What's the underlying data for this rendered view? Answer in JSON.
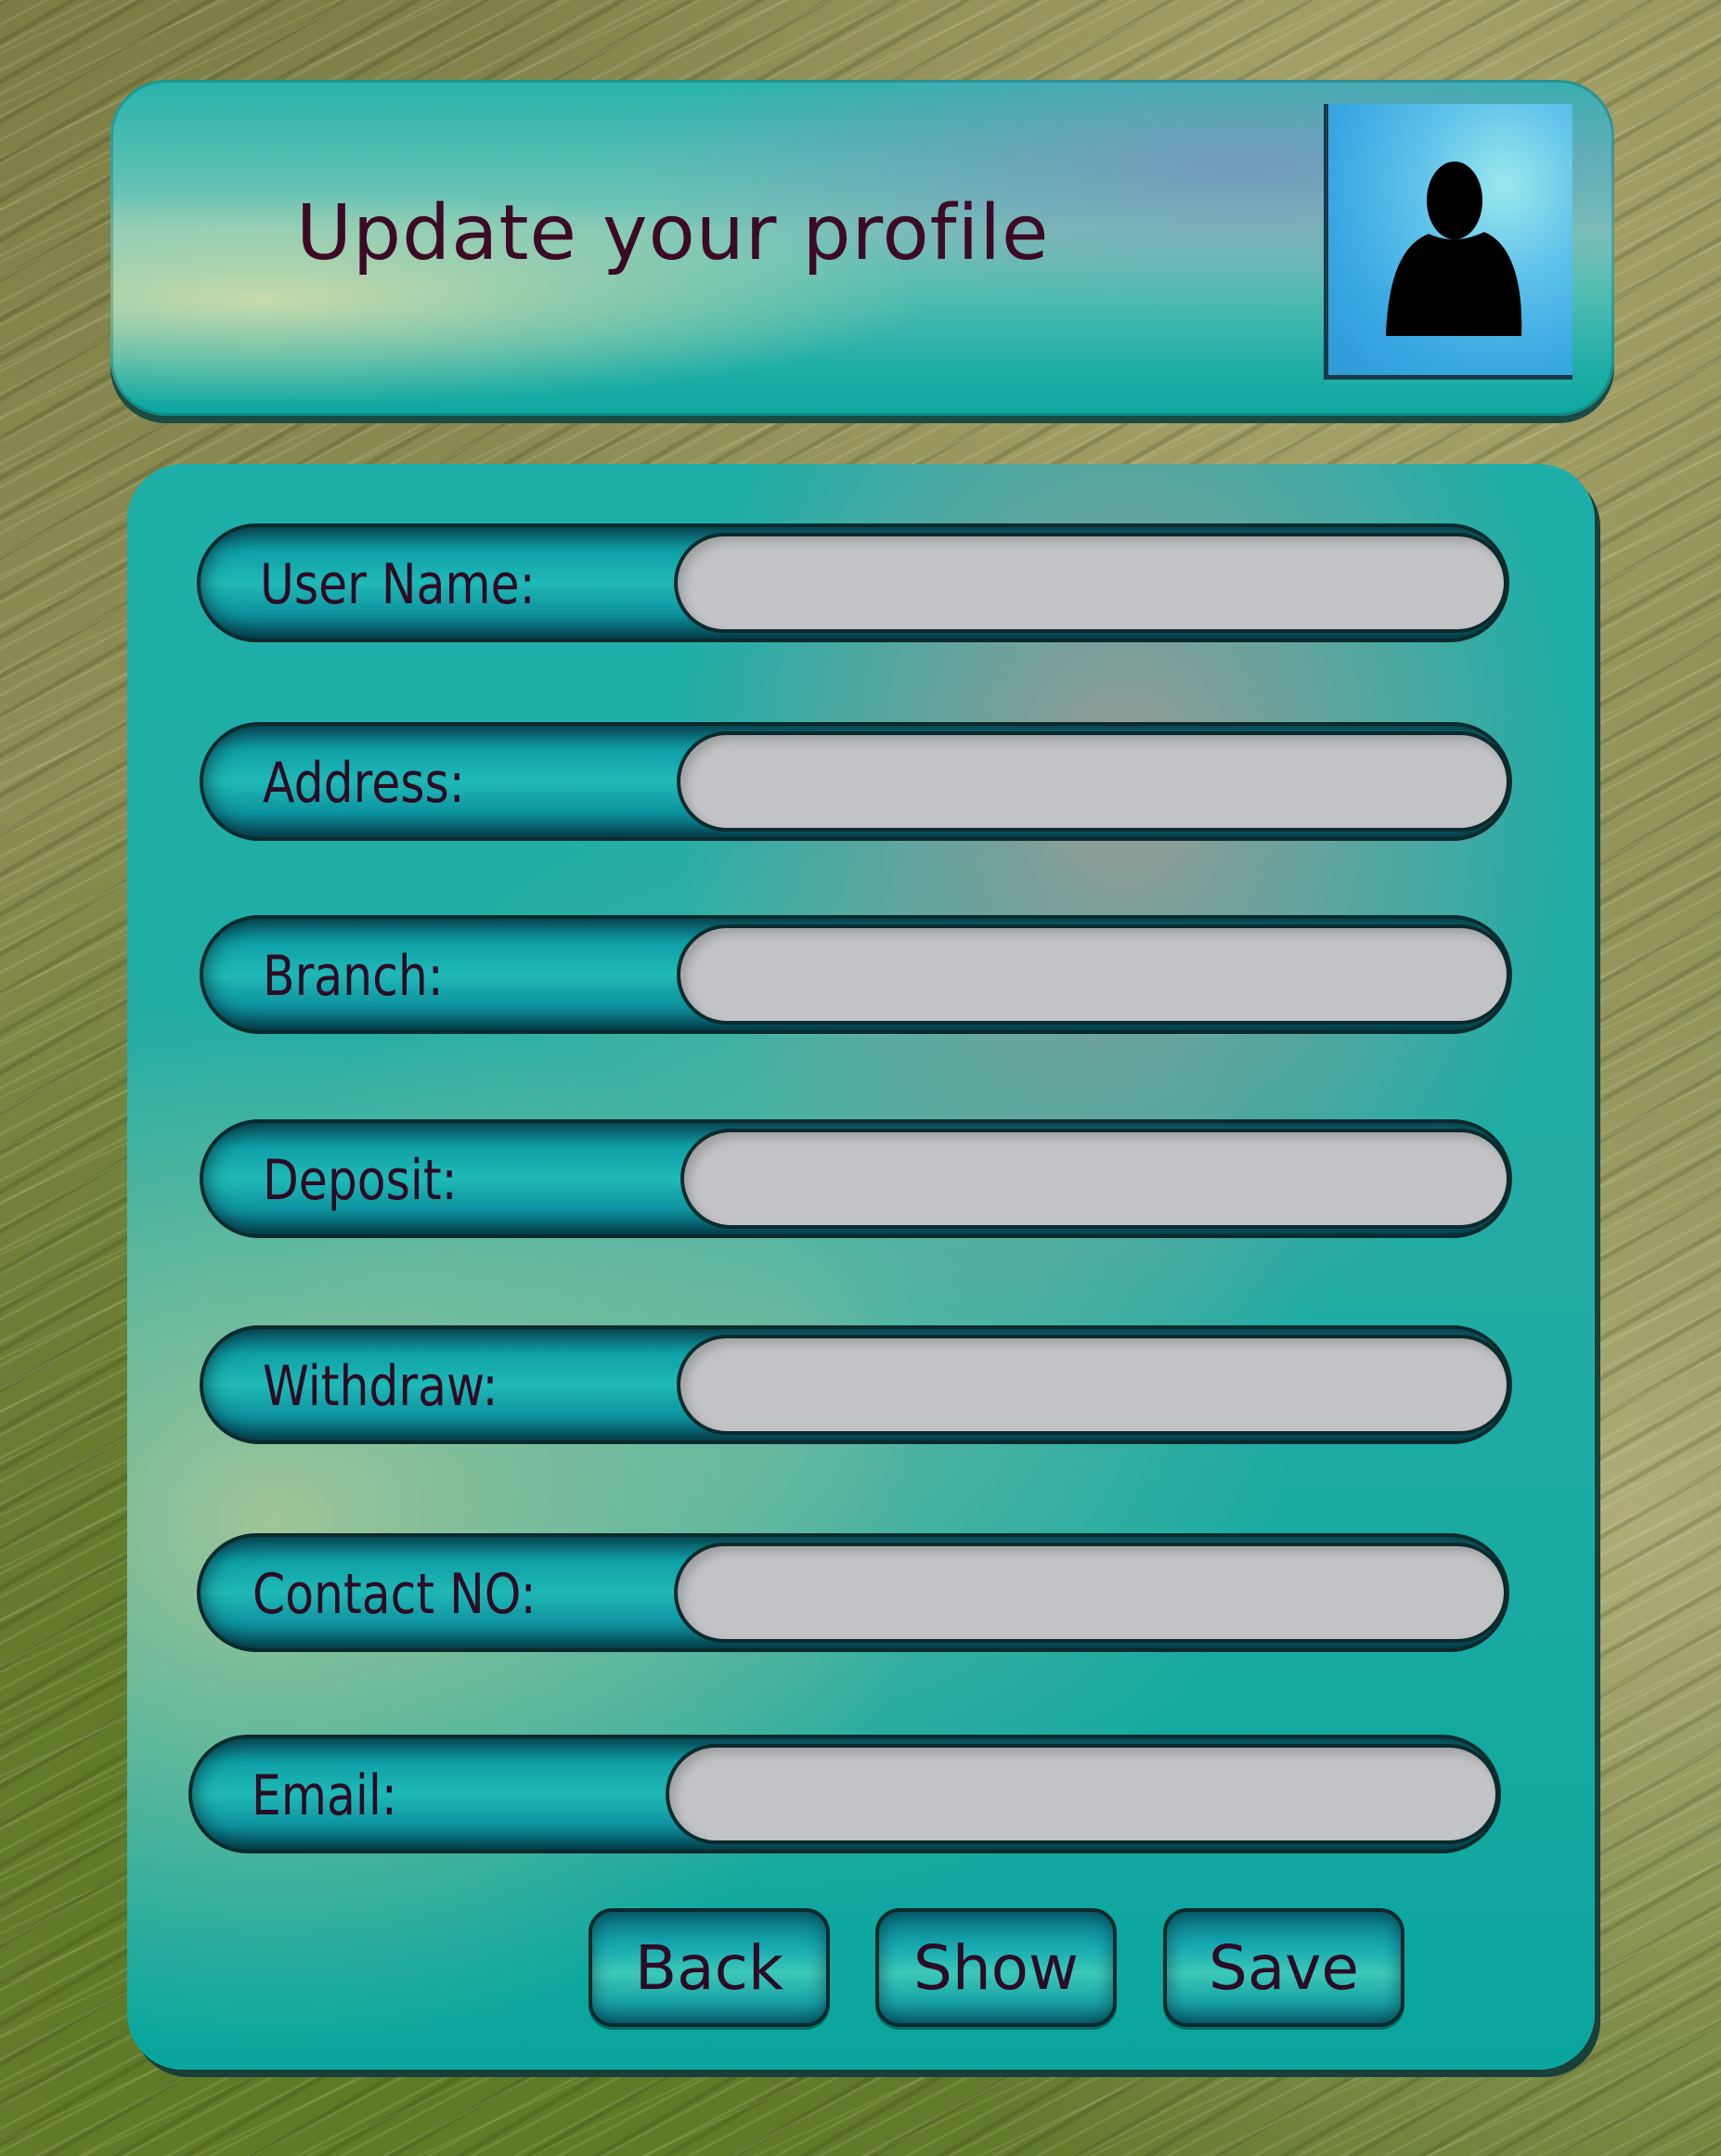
{
  "header": {
    "title": "Update your profile",
    "avatar_icon": "user-silhouette-icon"
  },
  "form": {
    "fields": [
      {
        "label": "User Name:",
        "value": ""
      },
      {
        "label": "Address:",
        "value": ""
      },
      {
        "label": "Branch:",
        "value": ""
      },
      {
        "label": "Deposit:",
        "value": ""
      },
      {
        "label": "Withdraw:",
        "value": ""
      },
      {
        "label": "Contact NO:",
        "value": ""
      },
      {
        "label": "Email:",
        "value": ""
      }
    ]
  },
  "buttons": {
    "back": "Back",
    "show": "Show",
    "save": "Save"
  },
  "colors": {
    "panel_teal": "#1eaea8",
    "input_gray": "#c2c3c6",
    "text_maroon": "#3d0a26",
    "avatar_blue": "#38a7e2"
  }
}
